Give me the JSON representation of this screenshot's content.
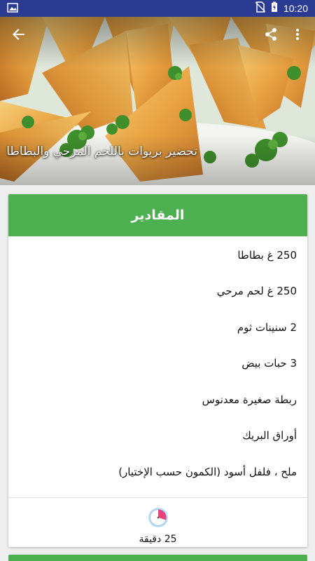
{
  "status_bar": {
    "time": "10:20",
    "icons": [
      "image-notification-icon",
      "no-sim-icon",
      "battery-charging-icon"
    ]
  },
  "hero": {
    "title": "تحضير بريوات باللحم المرحي والبطاطا",
    "icons": [
      "back-arrow-icon",
      "share-icon",
      "more-vert-icon"
    ]
  },
  "ingredients_card": {
    "header": "المقادير",
    "items": [
      "250 غ بطاطا",
      "250 غ لحم مرحي",
      "2 سنينات ثوم",
      "3 حبات بيض",
      "ربطة صغيرة معدنوس",
      "أوراق البريك",
      "ملح ، فلفل أسود (الكمون حسب الإختيار)"
    ],
    "time_icon": "clock-icon",
    "time_text": "25 دقيقة"
  },
  "colors": {
    "status_bar": "#2a3b91",
    "header_green": "#4caf50",
    "clock_pink": "#e91e63",
    "clock_blue": "#90caf9"
  }
}
